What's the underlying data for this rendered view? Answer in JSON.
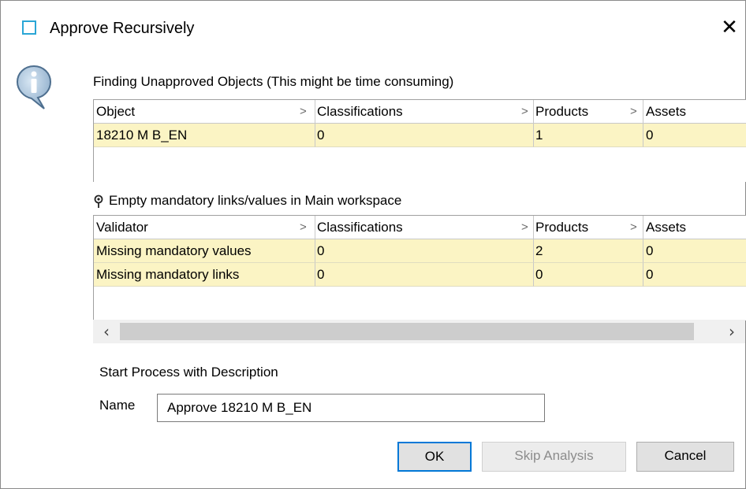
{
  "dialog": {
    "title": "Approve Recursively",
    "close_glyph": "✕",
    "title_icon": "window-square-icon",
    "info_icon": "info-icon"
  },
  "unapproved": {
    "label": "Finding Unapproved Objects (This might be time consuming)",
    "columns": [
      "Object",
      "Classifications",
      "Products",
      "Assets"
    ],
    "rows": [
      [
        "18210 M B_EN",
        "0",
        "1",
        "0"
      ]
    ]
  },
  "validation": {
    "label": "Empty mandatory links/values in Main workspace",
    "icon": "pin-icon",
    "columns": [
      "Validator",
      "Classifications",
      "Products",
      "Assets"
    ],
    "rows": [
      [
        "Missing mandatory values",
        "0",
        "2",
        "0"
      ],
      [
        "Missing mandatory links",
        "0",
        "0",
        "0"
      ]
    ]
  },
  "scrollbar": {
    "left_glyph": "‹",
    "right_glyph": "›"
  },
  "process": {
    "label": "Start Process with Description",
    "name_label": "Name",
    "name_value": "Approve 18210 M B_EN"
  },
  "buttons": {
    "ok": "OK",
    "skip": "Skip Analysis",
    "cancel": "Cancel"
  },
  "colors": {
    "row_highlight": "#fbf4c4",
    "accent": "#0078d7",
    "title_icon": "#2aa6d6"
  }
}
